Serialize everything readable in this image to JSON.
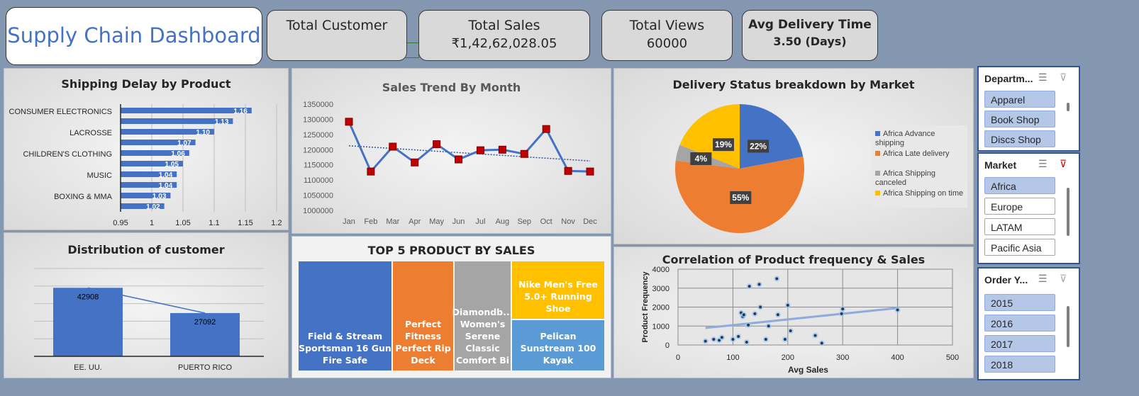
{
  "dashboard_title": "Supply Chain Dashboard",
  "kpis": {
    "customer": {
      "title": "Total Customer"
    },
    "sales": {
      "title": "Total Sales",
      "value": "₹1,42,62,028.05"
    },
    "views": {
      "title": "Total Views",
      "value": "60000"
    },
    "delivery": {
      "title": "Avg Delivery Time",
      "value": "3.50 (Days)"
    }
  },
  "chart_data": [
    {
      "id": "shipping_delay",
      "type": "bar",
      "title": "Shipping Delay by Product",
      "orientation": "horizontal",
      "values": [
        1.16,
        1.13,
        1.1,
        1.07,
        1.06,
        1.05,
        1.04,
        1.04,
        1.03,
        1.02
      ],
      "category_labels": [
        "CONSUMER ELECTRONICS",
        "LACROSSE",
        "CHILDREN'S CLOTHING",
        "MUSIC",
        "BOXING & MMA"
      ],
      "xticks": [
        "0.95",
        "1",
        "1.05",
        "1.1",
        "1.15",
        "1.2"
      ],
      "xlim": [
        0.95,
        1.2
      ],
      "color": "#4472c4"
    },
    {
      "id": "sales_trend",
      "type": "line",
      "title": "Sales Trend By Month",
      "x": [
        "Jan",
        "Feb",
        "Mar",
        "Apr",
        "May",
        "Jun",
        "Jul",
        "Aug",
        "Sep",
        "Oct",
        "Nov",
        "Dec"
      ],
      "values": [
        1292000,
        1128000,
        1210000,
        1158000,
        1218000,
        1168000,
        1198000,
        1200000,
        1186000,
        1268000,
        1130000,
        1128000
      ],
      "trendline": [
        1213000,
        1163000
      ],
      "ylim": [
        1000000,
        1350000
      ],
      "yticks": [
        "1000000",
        "1050000",
        "1100000",
        "1150000",
        "1200000",
        "1250000",
        "1300000",
        "1350000"
      ],
      "line_color": "#4472c4",
      "marker_color": "#c00000"
    },
    {
      "id": "delivery_status",
      "type": "pie",
      "title": "Delivery Status breakdown by Market",
      "labels": [
        "Africa Advance shipping",
        "Africa Late delivery",
        "Africa Shipping canceled",
        "Africa Shipping on time"
      ],
      "values": [
        22,
        55,
        4,
        19
      ],
      "value_labels": [
        "22%",
        "55%",
        "4%",
        "19%"
      ],
      "colors": [
        "#4472c4",
        "#ed7d31",
        "#a5a5a5",
        "#ffc000"
      ]
    },
    {
      "id": "customer_distribution",
      "type": "bar",
      "title": "Distribution of customer",
      "categories": [
        "EE. UU.",
        "PUERTO RICO"
      ],
      "values": [
        42908,
        27092
      ],
      "value_labels": [
        "42908",
        "27092"
      ],
      "ylim": [
        0,
        55000
      ],
      "color": "#4472c4"
    },
    {
      "id": "top5_products",
      "type": "treemap",
      "title": "TOP 5 PRODUCT BY SALES",
      "items": [
        {
          "label": "Field & Stream Sportsman 16 Gun Fire Safe",
          "color": "#4472c4"
        },
        {
          "label": "Perfect Fitness Perfect Rip Deck",
          "color": "#ed7d31"
        },
        {
          "label": "Diamondb... Women's Serene Classic Comfort Bi",
          "color": "#a5a5a5"
        },
        {
          "label": "Nike Men's Free 5.0+ Running Shoe",
          "color": "#ffc000"
        },
        {
          "label": "Pelican Sunstream 100 Kayak",
          "color": "#5b9bd5"
        }
      ]
    },
    {
      "id": "freq_vs_sales",
      "type": "scatter",
      "title": "Correlation of Product frequency & Sales",
      "xlabel": "Avg Sales",
      "ylabel": "Product Frequency",
      "xlim": [
        0,
        500
      ],
      "ylim": [
        0,
        4000
      ],
      "xticks": [
        "0",
        "100",
        "200",
        "300",
        "400",
        "500"
      ],
      "yticks": [
        "0",
        "1000",
        "2000",
        "3000",
        "4000"
      ],
      "points": [
        [
          50,
          200
        ],
        [
          65,
          300
        ],
        [
          75,
          250
        ],
        [
          80,
          400
        ],
        [
          100,
          300
        ],
        [
          110,
          450
        ],
        [
          115,
          1700
        ],
        [
          118,
          1500
        ],
        [
          120,
          1600
        ],
        [
          125,
          150
        ],
        [
          128,
          1050
        ],
        [
          130,
          3100
        ],
        [
          140,
          1650
        ],
        [
          148,
          3200
        ],
        [
          150,
          2000
        ],
        [
          160,
          300
        ],
        [
          165,
          1000
        ],
        [
          180,
          3500
        ],
        [
          182,
          1600
        ],
        [
          195,
          300
        ],
        [
          200,
          2100
        ],
        [
          205,
          750
        ],
        [
          250,
          500
        ],
        [
          262,
          100
        ],
        [
          298,
          1650
        ],
        [
          300,
          1900
        ],
        [
          400,
          1850
        ]
      ],
      "trendline": [
        [
          50,
          900
        ],
        [
          400,
          1950
        ]
      ]
    }
  ],
  "slicers": {
    "department": {
      "title": "Departm...",
      "items": [
        "Apparel",
        "Book Shop",
        "Discs Shop"
      ]
    },
    "market": {
      "title": "Market",
      "items": [
        "Africa",
        "Europe",
        "LATAM",
        "Pacific Asia"
      ]
    },
    "order_year": {
      "title": "Order Y...",
      "items": [
        "2015",
        "2016",
        "2017",
        "2018"
      ]
    }
  }
}
